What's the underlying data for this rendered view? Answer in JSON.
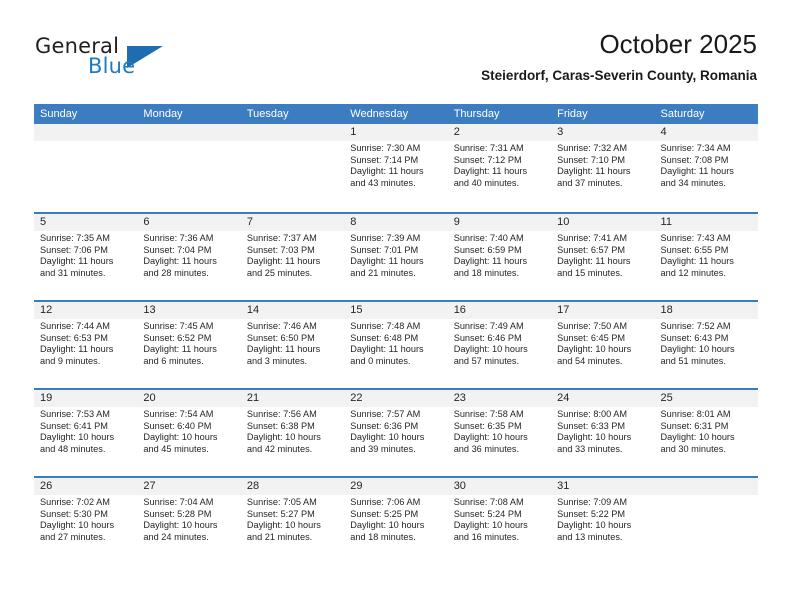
{
  "brand": {
    "word1": "General",
    "word2": "Blue",
    "logo_icon": "blue-triangle-icon"
  },
  "header": {
    "title": "October 2025",
    "subtitle": "Steierdorf, Caras-Severin County, Romania"
  },
  "calendar": {
    "weekdays": [
      "Sunday",
      "Monday",
      "Tuesday",
      "Wednesday",
      "Thursday",
      "Friday",
      "Saturday"
    ],
    "accent_color": "#3b7dc0",
    "day_band_color": "#f2f2f2",
    "weeks": [
      [
        {
          "day": "",
          "empty": true
        },
        {
          "day": "",
          "empty": true
        },
        {
          "day": "",
          "empty": true
        },
        {
          "day": "1",
          "sunrise": "Sunrise: 7:30 AM",
          "sunset": "Sunset: 7:14 PM",
          "daylight1": "Daylight: 11 hours",
          "daylight2": "and 43 minutes."
        },
        {
          "day": "2",
          "sunrise": "Sunrise: 7:31 AM",
          "sunset": "Sunset: 7:12 PM",
          "daylight1": "Daylight: 11 hours",
          "daylight2": "and 40 minutes."
        },
        {
          "day": "3",
          "sunrise": "Sunrise: 7:32 AM",
          "sunset": "Sunset: 7:10 PM",
          "daylight1": "Daylight: 11 hours",
          "daylight2": "and 37 minutes."
        },
        {
          "day": "4",
          "sunrise": "Sunrise: 7:34 AM",
          "sunset": "Sunset: 7:08 PM",
          "daylight1": "Daylight: 11 hours",
          "daylight2": "and 34 minutes."
        }
      ],
      [
        {
          "day": "5",
          "sunrise": "Sunrise: 7:35 AM",
          "sunset": "Sunset: 7:06 PM",
          "daylight1": "Daylight: 11 hours",
          "daylight2": "and 31 minutes."
        },
        {
          "day": "6",
          "sunrise": "Sunrise: 7:36 AM",
          "sunset": "Sunset: 7:04 PM",
          "daylight1": "Daylight: 11 hours",
          "daylight2": "and 28 minutes."
        },
        {
          "day": "7",
          "sunrise": "Sunrise: 7:37 AM",
          "sunset": "Sunset: 7:03 PM",
          "daylight1": "Daylight: 11 hours",
          "daylight2": "and 25 minutes."
        },
        {
          "day": "8",
          "sunrise": "Sunrise: 7:39 AM",
          "sunset": "Sunset: 7:01 PM",
          "daylight1": "Daylight: 11 hours",
          "daylight2": "and 21 minutes."
        },
        {
          "day": "9",
          "sunrise": "Sunrise: 7:40 AM",
          "sunset": "Sunset: 6:59 PM",
          "daylight1": "Daylight: 11 hours",
          "daylight2": "and 18 minutes."
        },
        {
          "day": "10",
          "sunrise": "Sunrise: 7:41 AM",
          "sunset": "Sunset: 6:57 PM",
          "daylight1": "Daylight: 11 hours",
          "daylight2": "and 15 minutes."
        },
        {
          "day": "11",
          "sunrise": "Sunrise: 7:43 AM",
          "sunset": "Sunset: 6:55 PM",
          "daylight1": "Daylight: 11 hours",
          "daylight2": "and 12 minutes."
        }
      ],
      [
        {
          "day": "12",
          "sunrise": "Sunrise: 7:44 AM",
          "sunset": "Sunset: 6:53 PM",
          "daylight1": "Daylight: 11 hours",
          "daylight2": "and 9 minutes."
        },
        {
          "day": "13",
          "sunrise": "Sunrise: 7:45 AM",
          "sunset": "Sunset: 6:52 PM",
          "daylight1": "Daylight: 11 hours",
          "daylight2": "and 6 minutes."
        },
        {
          "day": "14",
          "sunrise": "Sunrise: 7:46 AM",
          "sunset": "Sunset: 6:50 PM",
          "daylight1": "Daylight: 11 hours",
          "daylight2": "and 3 minutes."
        },
        {
          "day": "15",
          "sunrise": "Sunrise: 7:48 AM",
          "sunset": "Sunset: 6:48 PM",
          "daylight1": "Daylight: 11 hours",
          "daylight2": "and 0 minutes."
        },
        {
          "day": "16",
          "sunrise": "Sunrise: 7:49 AM",
          "sunset": "Sunset: 6:46 PM",
          "daylight1": "Daylight: 10 hours",
          "daylight2": "and 57 minutes."
        },
        {
          "day": "17",
          "sunrise": "Sunrise: 7:50 AM",
          "sunset": "Sunset: 6:45 PM",
          "daylight1": "Daylight: 10 hours",
          "daylight2": "and 54 minutes."
        },
        {
          "day": "18",
          "sunrise": "Sunrise: 7:52 AM",
          "sunset": "Sunset: 6:43 PM",
          "daylight1": "Daylight: 10 hours",
          "daylight2": "and 51 minutes."
        }
      ],
      [
        {
          "day": "19",
          "sunrise": "Sunrise: 7:53 AM",
          "sunset": "Sunset: 6:41 PM",
          "daylight1": "Daylight: 10 hours",
          "daylight2": "and 48 minutes."
        },
        {
          "day": "20",
          "sunrise": "Sunrise: 7:54 AM",
          "sunset": "Sunset: 6:40 PM",
          "daylight1": "Daylight: 10 hours",
          "daylight2": "and 45 minutes."
        },
        {
          "day": "21",
          "sunrise": "Sunrise: 7:56 AM",
          "sunset": "Sunset: 6:38 PM",
          "daylight1": "Daylight: 10 hours",
          "daylight2": "and 42 minutes."
        },
        {
          "day": "22",
          "sunrise": "Sunrise: 7:57 AM",
          "sunset": "Sunset: 6:36 PM",
          "daylight1": "Daylight: 10 hours",
          "daylight2": "and 39 minutes."
        },
        {
          "day": "23",
          "sunrise": "Sunrise: 7:58 AM",
          "sunset": "Sunset: 6:35 PM",
          "daylight1": "Daylight: 10 hours",
          "daylight2": "and 36 minutes."
        },
        {
          "day": "24",
          "sunrise": "Sunrise: 8:00 AM",
          "sunset": "Sunset: 6:33 PM",
          "daylight1": "Daylight: 10 hours",
          "daylight2": "and 33 minutes."
        },
        {
          "day": "25",
          "sunrise": "Sunrise: 8:01 AM",
          "sunset": "Sunset: 6:31 PM",
          "daylight1": "Daylight: 10 hours",
          "daylight2": "and 30 minutes."
        }
      ],
      [
        {
          "day": "26",
          "sunrise": "Sunrise: 7:02 AM",
          "sunset": "Sunset: 5:30 PM",
          "daylight1": "Daylight: 10 hours",
          "daylight2": "and 27 minutes."
        },
        {
          "day": "27",
          "sunrise": "Sunrise: 7:04 AM",
          "sunset": "Sunset: 5:28 PM",
          "daylight1": "Daylight: 10 hours",
          "daylight2": "and 24 minutes."
        },
        {
          "day": "28",
          "sunrise": "Sunrise: 7:05 AM",
          "sunset": "Sunset: 5:27 PM",
          "daylight1": "Daylight: 10 hours",
          "daylight2": "and 21 minutes."
        },
        {
          "day": "29",
          "sunrise": "Sunrise: 7:06 AM",
          "sunset": "Sunset: 5:25 PM",
          "daylight1": "Daylight: 10 hours",
          "daylight2": "and 18 minutes."
        },
        {
          "day": "30",
          "sunrise": "Sunrise: 7:08 AM",
          "sunset": "Sunset: 5:24 PM",
          "daylight1": "Daylight: 10 hours",
          "daylight2": "and 16 minutes."
        },
        {
          "day": "31",
          "sunrise": "Sunrise: 7:09 AM",
          "sunset": "Sunset: 5:22 PM",
          "daylight1": "Daylight: 10 hours",
          "daylight2": "and 13 minutes."
        },
        {
          "day": "",
          "empty": true
        }
      ]
    ]
  }
}
